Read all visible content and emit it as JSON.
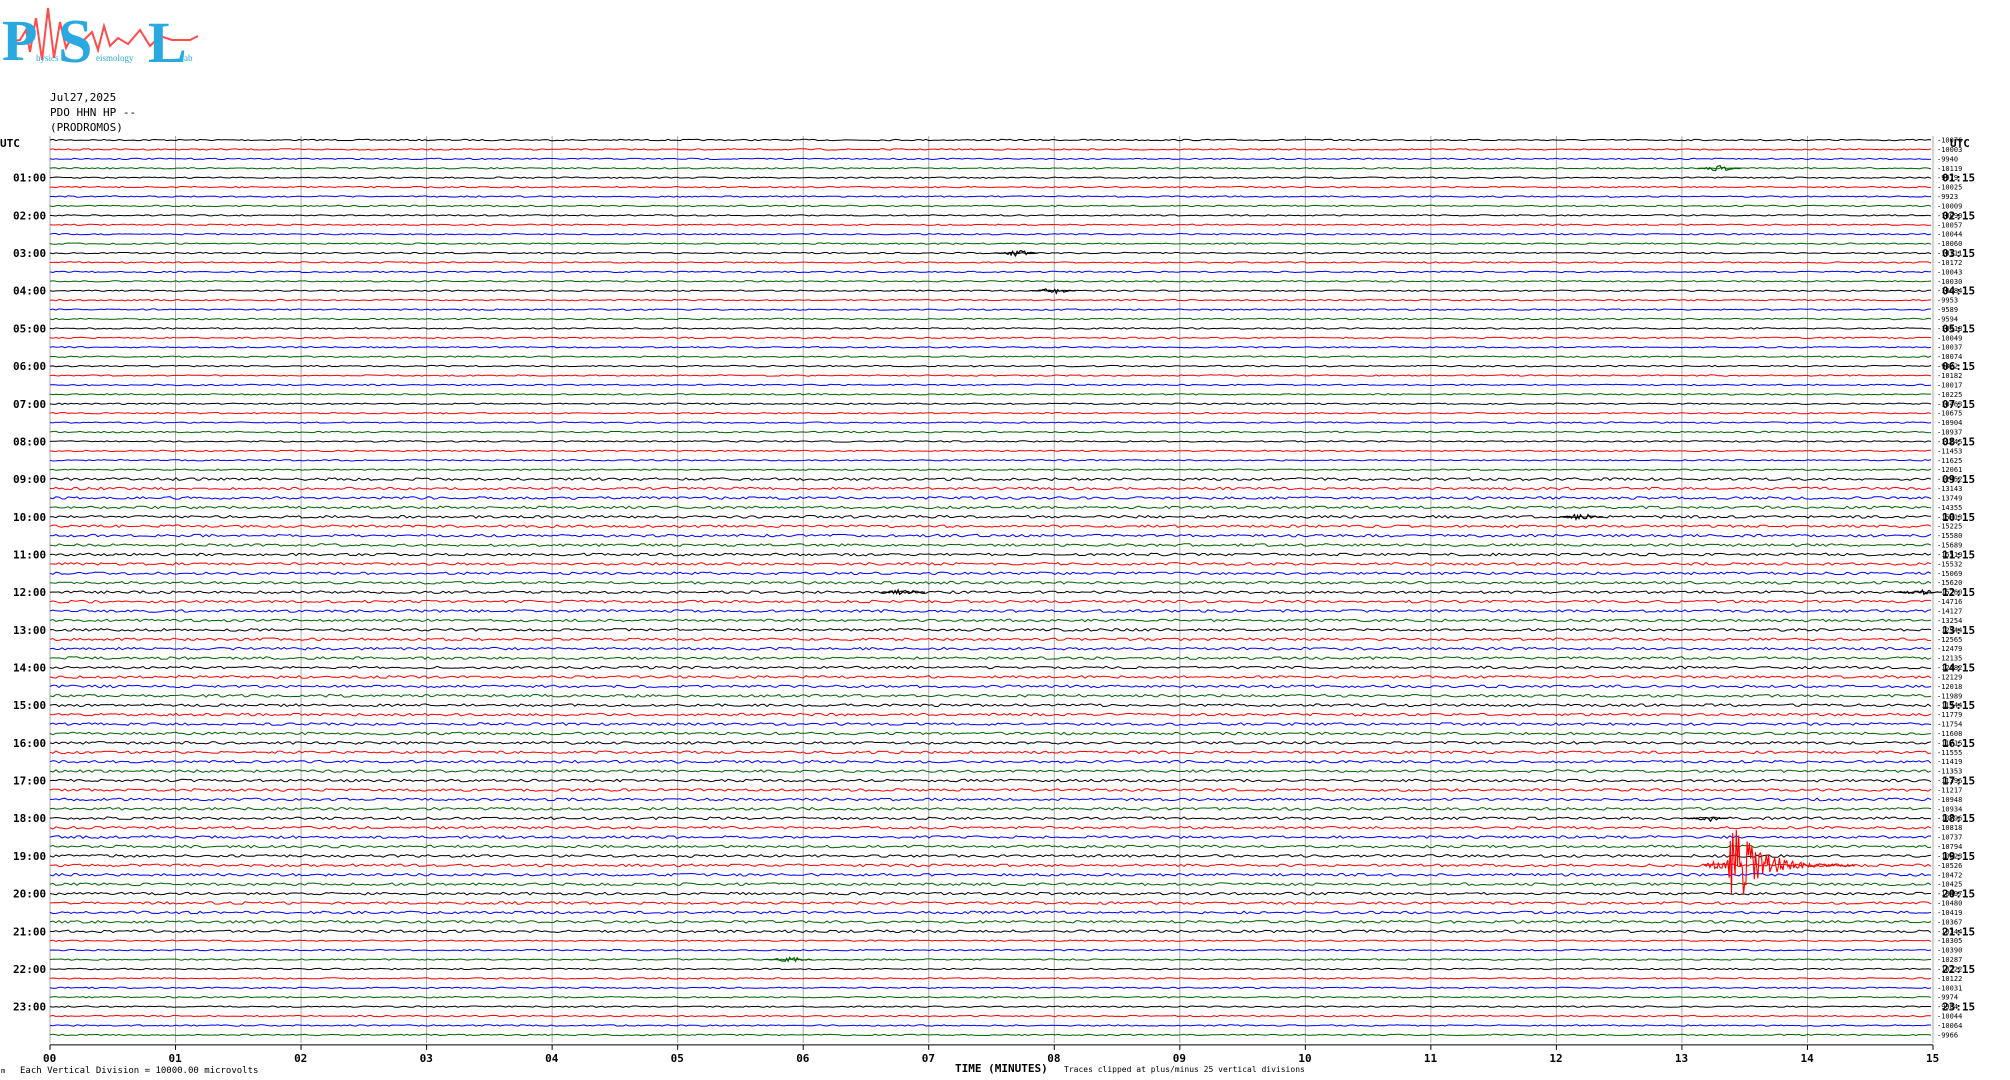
{
  "logo": {
    "letters": [
      "P",
      "S",
      "L"
    ],
    "subtitle_fragments": [
      "hysics",
      "eismology",
      "ab"
    ],
    "colors": {
      "letters": "#29a9e0",
      "waveform": "#ff4b4b"
    }
  },
  "header": {
    "date": "Jul27,2025",
    "channel": "PDO HHN HP --",
    "station": "(PRODROMOS)"
  },
  "footer": {
    "scale_note": "Each Vertical Division = 10000.00 microvolts",
    "x_axis_title": "TIME (MINUTES)",
    "clip_note": "Traces clipped at plus/minus 25 vertical divisions",
    "corner_mark": "m"
  },
  "chart_data": {
    "type": "line",
    "subtype": "helicorder",
    "utc_label_left": "UTC",
    "utc_label_right": "UTC",
    "xlabel": "TIME (MINUTES)",
    "xlim": [
      0,
      15
    ],
    "x_ticks": [
      "00",
      "01",
      "02",
      "03",
      "04",
      "05",
      "06",
      "07",
      "08",
      "09",
      "10",
      "11",
      "12",
      "13",
      "14",
      "15"
    ],
    "vertical_grid": true,
    "trace_colors": [
      "#000000",
      "#ff0000",
      "#0000ff",
      "#006400"
    ],
    "left_hour_labels": [
      "01:00",
      "02:00",
      "03:00",
      "04:00",
      "05:00",
      "06:00",
      "07:00",
      "08:00",
      "09:00",
      "10:00",
      "11:00",
      "12:00",
      "13:00",
      "14:00",
      "15:00",
      "16:00",
      "17:00",
      "18:00",
      "19:00",
      "20:00",
      "21:00",
      "22:00",
      "23:00"
    ],
    "right_hour_labels": [
      "01:15",
      "02:15",
      "03:15",
      "04:15",
      "05:15",
      "06:15",
      "07:15",
      "08:15",
      "09:15",
      "10:15",
      "11:15",
      "12:15",
      "13:15",
      "14:15",
      "15:15",
      "16:15",
      "17:15",
      "18:15",
      "19:15",
      "20:15",
      "21:15",
      "22:15",
      "23:15"
    ],
    "trace_offsets": [
      "-10076",
      "-10003",
      "-9940",
      "-10119",
      "-9979",
      "-10025",
      "-9923",
      "-10009",
      "-10090",
      "-10057",
      "-10044",
      "-10060",
      "-10111",
      "-10172",
      "-10043",
      "-10030",
      "-10084",
      "-9953",
      "-9589",
      "-9594",
      "-10018",
      "-10049",
      "-10037",
      "-10074",
      "-9822",
      "-10182",
      "-10017",
      "-10225",
      "-10463",
      "-10675",
      "-10904",
      "-10937",
      "-11245",
      "-11453",
      "-11625",
      "-12061",
      "-12452",
      "-13143",
      "-13749",
      "-14355",
      "-15013",
      "-15225",
      "-15580",
      "-15689",
      "-15519",
      "-15532",
      "-15069",
      "-15620",
      "-15260",
      "-14716",
      "-14127",
      "-13254",
      "-12944",
      "-12565",
      "-12479",
      "-12135",
      "-12182",
      "-12129",
      "-12018",
      "-11989",
      "-11944",
      "-11779",
      "-11754",
      "-11608",
      "-11715",
      "-11555",
      "-11419",
      "-11353",
      "-11396",
      "-11217",
      "-10948",
      "-10934",
      "-10796",
      "-10818",
      "-10737",
      "-10794",
      "-10623",
      "-10526",
      "-10472",
      "-10425",
      "-10497",
      "-10480",
      "-10419",
      "-10367",
      "-10344",
      "-10305",
      "-10390",
      "-10287",
      "-10222",
      "-10122",
      "-10031",
      "-9974",
      "-9984",
      "-10044",
      "-10064",
      "-9966"
    ],
    "events": [
      {
        "trace": 3,
        "minute": 13.3,
        "amplitude": "small"
      },
      {
        "trace": 12,
        "minute": 7.7,
        "amplitude": "small"
      },
      {
        "trace": 16,
        "minute": 8.0,
        "amplitude": "small"
      },
      {
        "trace": 40,
        "minute": 12.2,
        "amplitude": "small"
      },
      {
        "trace": 48,
        "minute": 6.8,
        "amplitude": "small"
      },
      {
        "trace": 48,
        "minute": 14.9,
        "amplitude": "small"
      },
      {
        "trace": 72,
        "minute": 13.2,
        "amplitude": "small"
      },
      {
        "trace": 77,
        "minute": 13.35,
        "amplitude": "large"
      },
      {
        "trace": 87,
        "minute": 5.9,
        "amplitude": "small"
      }
    ]
  }
}
